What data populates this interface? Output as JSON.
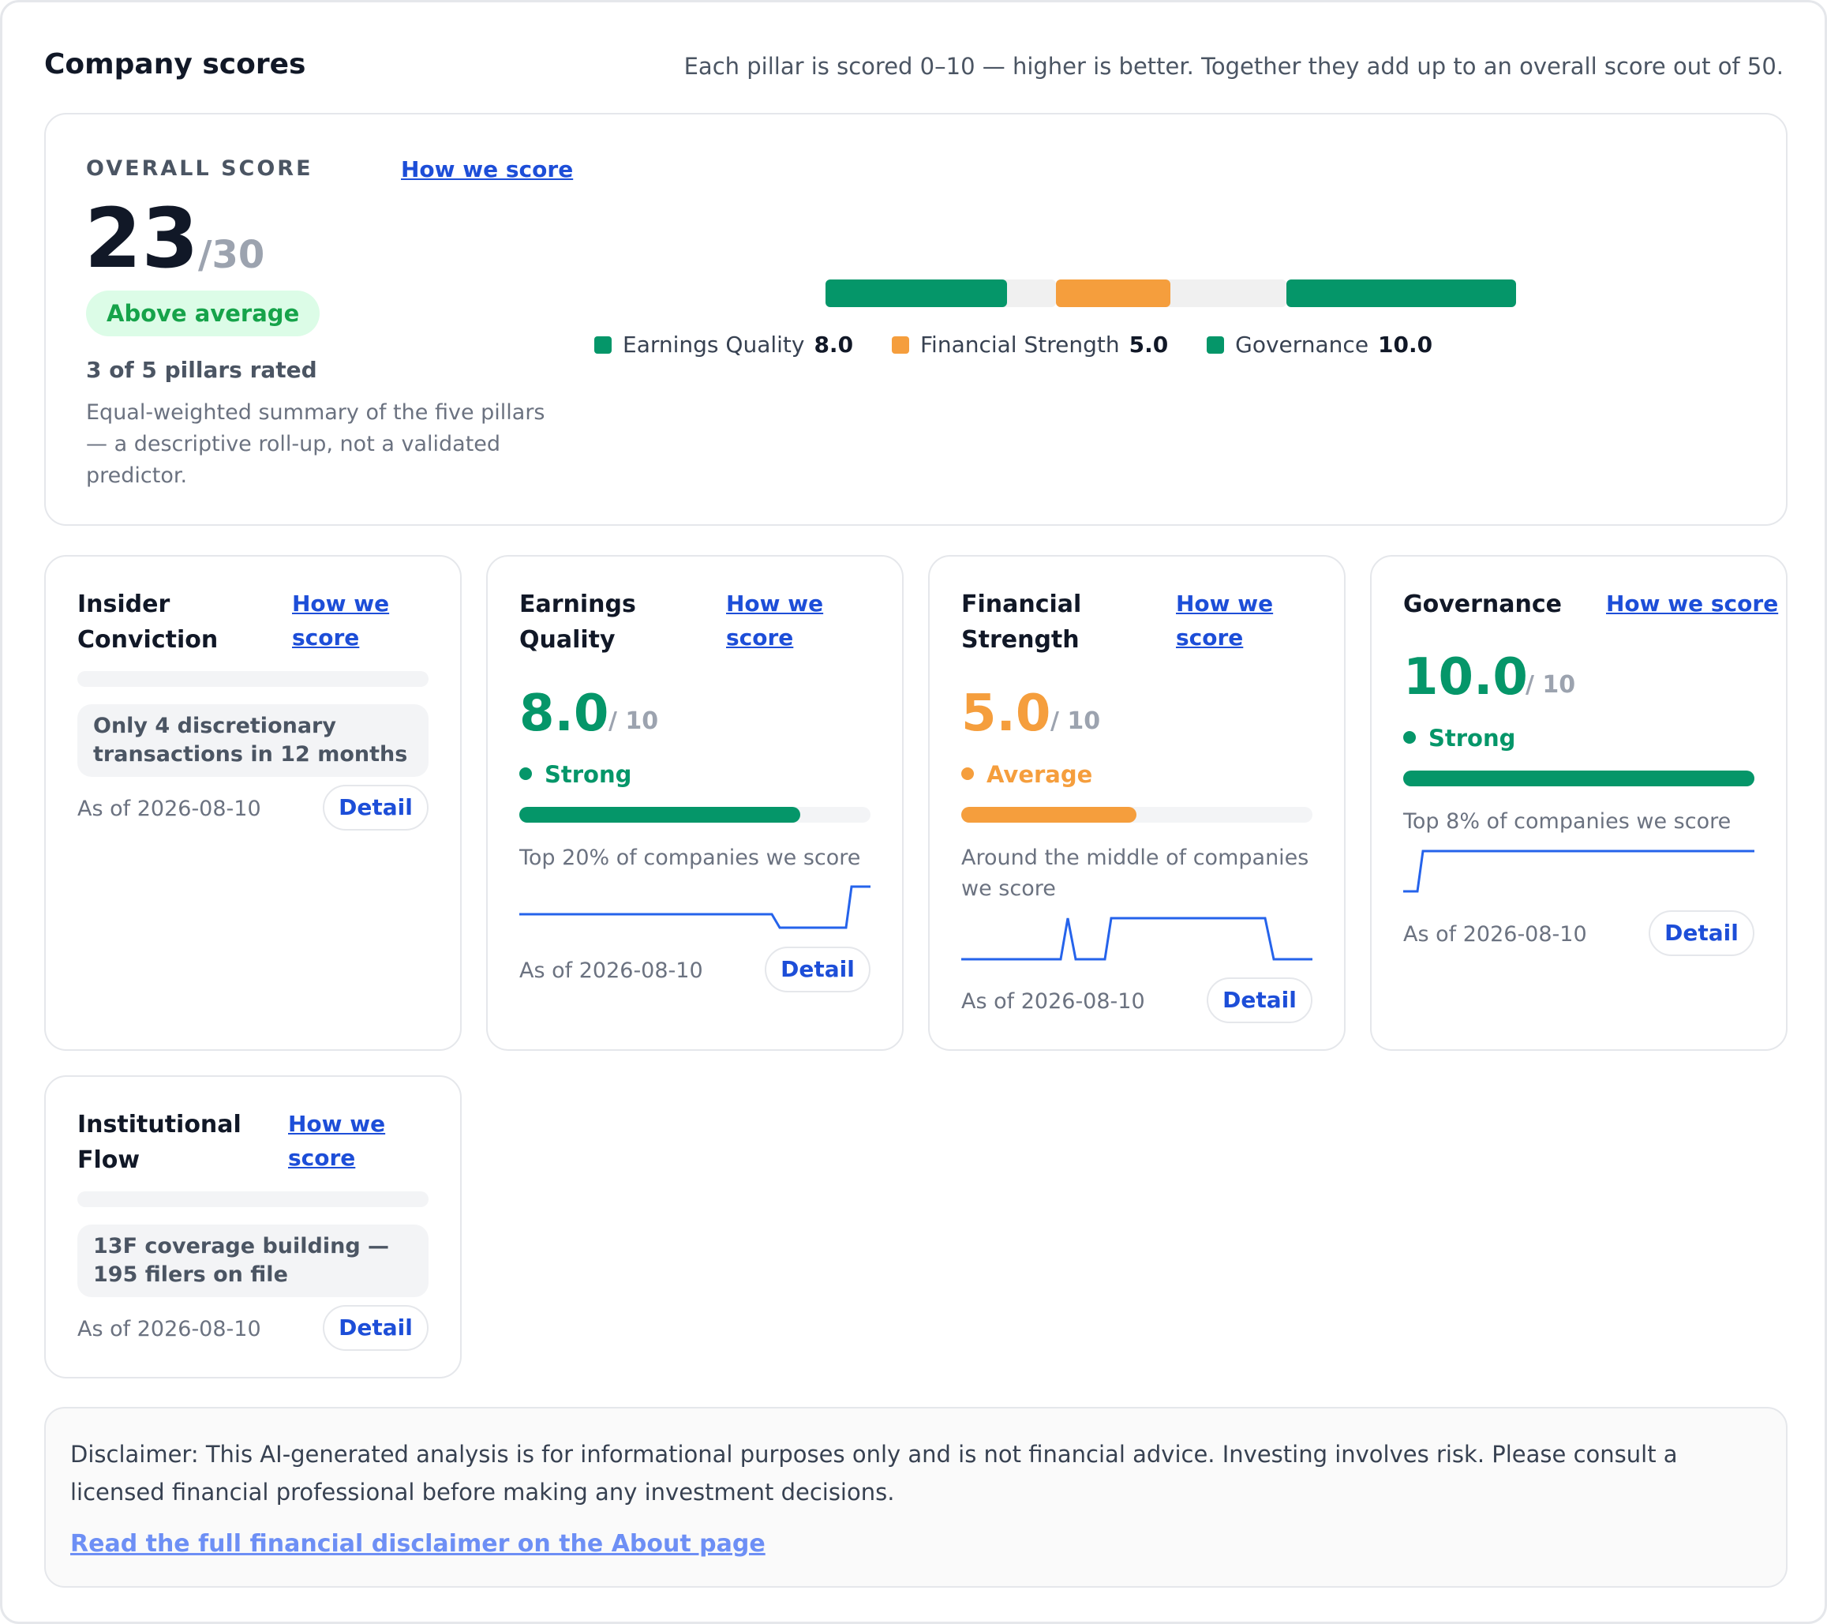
{
  "header": {
    "title": "Company scores",
    "subtitle": "Each pillar is scored 0–10 — higher is better. Together they add up to an overall score out of 50."
  },
  "overall": {
    "label": "OVERALL SCORE",
    "how_link": "How we score",
    "score": "23",
    "max": "/30",
    "badge": "Above average",
    "rated": "3 of 5 pillars rated",
    "note": "Equal-weighted summary of the five pillars — a descriptive roll-up, not a validated predictor.",
    "legend": [
      {
        "name": "Earnings Quality",
        "value": "8.0",
        "color": "#059669"
      },
      {
        "name": "Financial Strength",
        "value": "5.0",
        "color": "#f59e3d"
      },
      {
        "name": "Governance",
        "value": "10.0",
        "color": "#059669"
      }
    ]
  },
  "pillars": [
    {
      "title_line1": "Insider",
      "title_line2": "Conviction",
      "how_line1": "How we",
      "how_line2": "score",
      "note": "Only 4 discretionary transactions in 12 months",
      "as_of": "As of 2026-08-10",
      "detail": "Detail"
    },
    {
      "title_line1": "Earnings",
      "title_line2": "Quality",
      "how_line1": "How we",
      "how_line2": "score",
      "score": "8.0",
      "max": "/ 10",
      "score_fraction": 0.8,
      "status": "Strong",
      "color": "#059669",
      "rank": "Top 20% of companies we score",
      "as_of": "As of 2026-08-10",
      "detail": "Detail"
    },
    {
      "title_line1": "Financial",
      "title_line2": "Strength",
      "how_line1": "How we",
      "how_line2": "score",
      "score": "5.0",
      "max": "/ 10",
      "score_fraction": 0.5,
      "status": "Average",
      "color": "#f59e3d",
      "rank": "Around the middle of companies we score",
      "as_of": "As of 2026-08-10",
      "detail": "Detail"
    },
    {
      "title": "Governance",
      "how": "How we score",
      "score": "10.0",
      "max": "/ 10",
      "score_fraction": 1.0,
      "status": "Strong",
      "color": "#059669",
      "rank": "Top 8% of companies we score",
      "as_of": "As of 2026-08-10",
      "detail": "Detail"
    },
    {
      "title_line1": "Institutional",
      "title_line2": "Flow",
      "how_line1": "How we",
      "how_line2": "score",
      "note": "13F coverage building — 195 filers on file",
      "as_of": "As of 2026-08-10",
      "detail": "Detail"
    }
  ],
  "disclaimer": {
    "text": "Disclaimer: This AI-generated analysis is for informational purposes only and is not financial advice. Investing involves risk. Please consult a licensed financial professional before making any investment decisions.",
    "link": "Read the full financial disclaimer on the About page"
  }
}
